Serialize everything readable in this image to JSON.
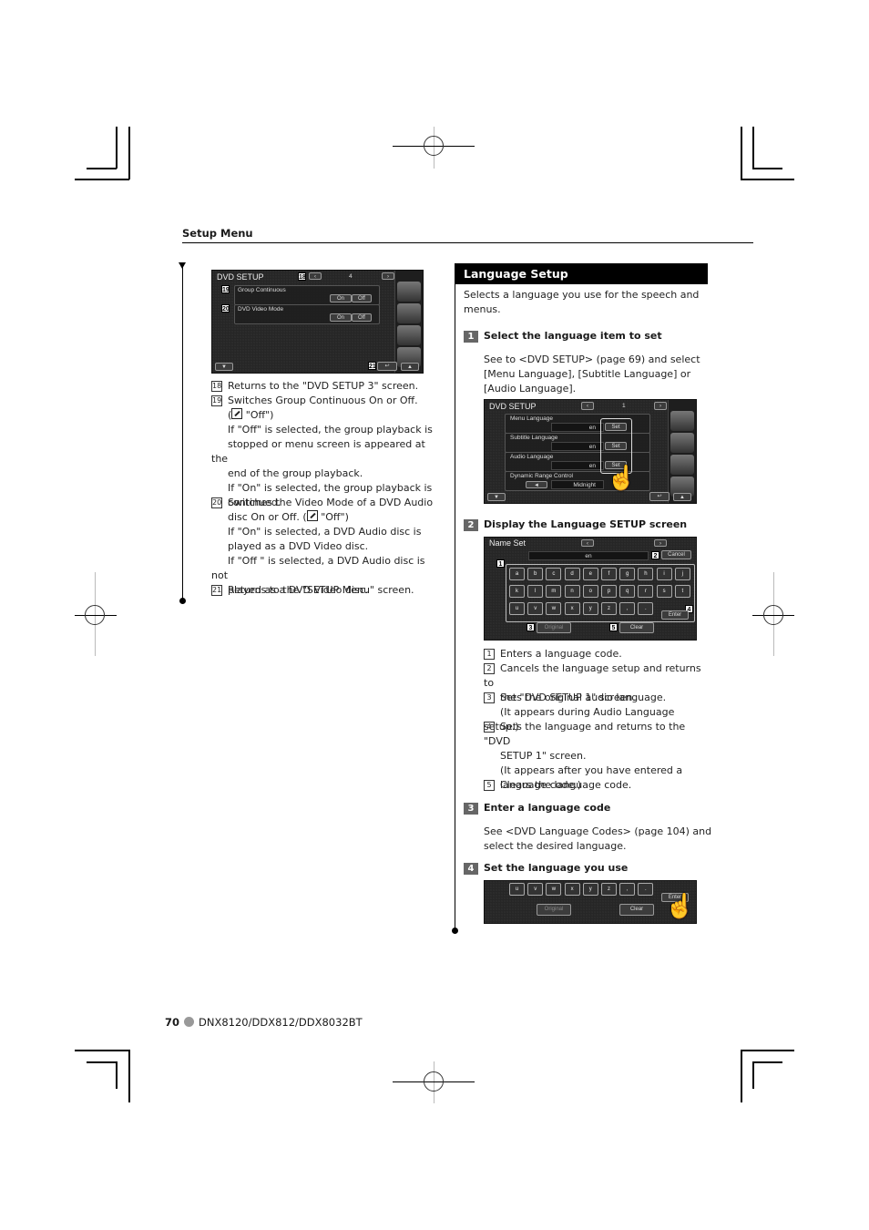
{
  "header": {
    "section": "Setup Menu"
  },
  "left": {
    "screen": {
      "title": "DVD SETUP",
      "page": "4",
      "rows": [
        {
          "label": "Group Continuous",
          "on": "On",
          "off": "Off"
        },
        {
          "label": "DVD Video Mode",
          "on": "On",
          "off": "Off"
        }
      ],
      "callouts": [
        "18",
        "19",
        "20",
        "21"
      ]
    },
    "items": [
      {
        "num": "18",
        "lines": [
          "Returns to the \"DVD SETUP 3\" screen."
        ]
      },
      {
        "num": "19",
        "lines": [
          "Switches Group Continuous On or Off.",
          "\"Off\")",
          "If \"Off\" is selected, the group playback is",
          "stopped or menu screen is appeared at the",
          "end of the group playback.",
          "If \"On\" is selected, the group playback is",
          "continued."
        ]
      },
      {
        "num": "20",
        "lines": [
          "Switches the Video Mode of a DVD Audio",
          "disc On or Off. (",
          "\"Off\")",
          "If \"On\" is selected, a DVD Audio disc is",
          "played as a DVD Video disc.",
          "If \"Off \" is selected, a DVD Audio disc is not",
          "played as a DVD Video disc."
        ]
      },
      {
        "num": "21",
        "lines": [
          "Returns to the \"SETUP Menu\" screen."
        ]
      }
    ]
  },
  "right": {
    "title": "Language Setup",
    "intro": [
      "Selects a language you use for the speech and",
      "menus."
    ],
    "steps": [
      {
        "num": "1",
        "title": "Select the language item to set",
        "body": [
          "See to <DVD SETUP> (page 69) and select",
          "[Menu Language], [Subtitle Language] or",
          "[Audio Language]."
        ]
      },
      {
        "num": "2",
        "title": "Display the Language SETUP screen"
      },
      {
        "num": "3",
        "title": "Enter a language code",
        "body": [
          "See <DVD Language Codes> (page 104) and",
          "select the desired language."
        ]
      },
      {
        "num": "4",
        "title": "Set the language you use"
      }
    ],
    "dvd_setup_screen": {
      "title": "DVD SETUP",
      "page": "1",
      "rows": [
        {
          "label": "Menu Language",
          "value": "en",
          "button": "Set"
        },
        {
          "label": "Subtitle Language",
          "value": "en",
          "button": "Set"
        },
        {
          "label": "Audio Language",
          "value": "en",
          "button": "Set"
        },
        {
          "label": "Dynamic Range Control",
          "value": "Midnight"
        }
      ]
    },
    "name_set_screen": {
      "title": "Name Set",
      "input": "en",
      "cancel": "Cancel",
      "keys_row1": [
        "a",
        "b",
        "c",
        "d",
        "e",
        "f",
        "g",
        "h",
        "i",
        "j"
      ],
      "keys_row2": [
        "k",
        "l",
        "m",
        "n",
        "o",
        "p",
        "q",
        "r",
        "s",
        "t"
      ],
      "keys_row3": [
        "u",
        "v",
        "w",
        "x",
        "y",
        "z",
        ",",
        "."
      ],
      "enter": "Enter",
      "original": "Original",
      "clear": "Clear",
      "callouts": [
        "1",
        "2",
        "3",
        "4",
        "5"
      ]
    },
    "legend": [
      {
        "num": "1",
        "lines": [
          "Enters a language code."
        ]
      },
      {
        "num": "2",
        "lines": [
          "Cancels the language setup and returns to",
          "the \"DVD SETUP 1\" screen."
        ]
      },
      {
        "num": "3",
        "lines": [
          "Sets the original audio language.",
          "(It appears during Audio Language setup.)"
        ]
      },
      {
        "num": "4",
        "lines": [
          "Sets the language and returns to the \"DVD",
          "SETUP 1\" screen.",
          "(It appears after you have entered a",
          "language code.)"
        ]
      },
      {
        "num": "5",
        "lines": [
          "Clears the language code."
        ]
      }
    ]
  },
  "footer": {
    "page": "70",
    "models": "DNX8120/DDX812/DDX8032BT"
  }
}
